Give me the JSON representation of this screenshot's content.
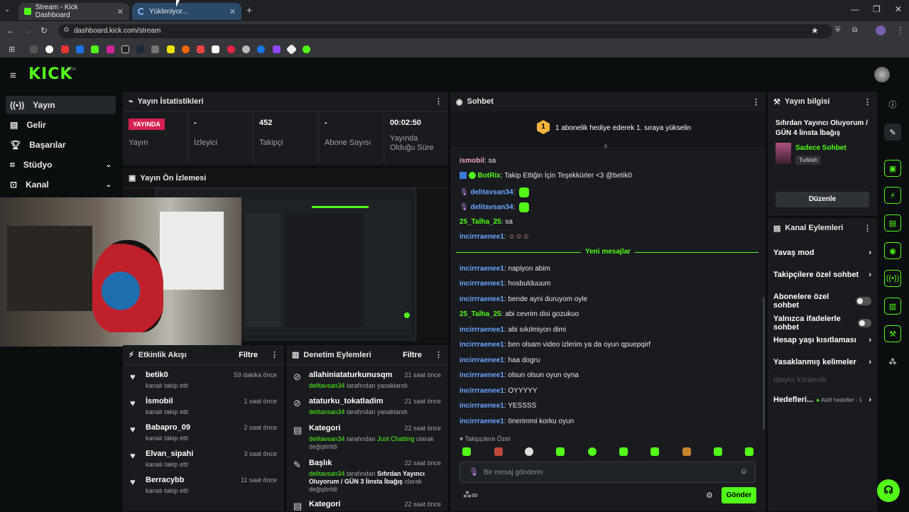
{
  "browser": {
    "tabs": [
      {
        "title": "Stream - Kick Dashboard"
      },
      {
        "title": "Yükleniyor..."
      }
    ],
    "url": "dashboard.kick.com/stream",
    "new_tab": "+"
  },
  "app": {
    "logo": "KICK",
    "badge": "BETA",
    "accent": "#53fc18",
    "live_color": "#d6204f"
  },
  "sidebar": {
    "items": [
      {
        "label": "Yayın",
        "icon": "broadcast-icon"
      },
      {
        "label": "Gelir",
        "icon": "revenue-icon"
      },
      {
        "label": "Başarılar",
        "icon": "trophy-icon"
      },
      {
        "label": "Stüdyo",
        "icon": "studio-icon"
      },
      {
        "label": "Kanal",
        "icon": "channel-icon"
      }
    ]
  },
  "stats": {
    "title": "Yayın İstatistikleri",
    "live_badge": "YAYINDA",
    "live_label": "Yayın",
    "viewers_value": "-",
    "viewers_label": "İzleyici",
    "followers_value": "452",
    "followers_label": "Takipçi",
    "subs_value": "-",
    "subs_label": "Abone Sayısı",
    "duration_value": "00:02:50",
    "duration_label": "Yayında Olduğu Süre"
  },
  "preview": {
    "title": "Yayın Ön İzlemesi"
  },
  "activity": {
    "title": "Etkinlik Akışı",
    "filter": "Filtre",
    "items": [
      {
        "name": "betik0",
        "sub": "kanalı takip etti",
        "time": "59 dakika önce"
      },
      {
        "name": "İsmobil",
        "sub": "kanalı takip etti",
        "time": "1 saat önce"
      },
      {
        "name": "Babapro_09",
        "sub": "kanalı takip etti",
        "time": "2 saat önce"
      },
      {
        "name": "Elvan_sipahi",
        "sub": "kanalı takip etti",
        "time": "3 saat önce"
      },
      {
        "name": "Berracybb",
        "sub": "kanalı takip etti",
        "time": "11 saat önce"
      }
    ]
  },
  "moderation": {
    "title": "Denetim Eylemleri",
    "filter": "Filtre",
    "items": [
      {
        "name": "allahiniataturkunusqm",
        "user": "delitavsan34",
        "rest": "tarafından yasaklandı",
        "time": "21 saat önce"
      },
      {
        "name": "ataturku_tokatladim",
        "user": "delitavsan34",
        "rest": "tarafından yasaklandı",
        "time": "21 saat önce"
      },
      {
        "name": "Kategori",
        "user": "delitavsan34",
        "mid": "tarafından",
        "value": "Just Chatting",
        "rest": "olarak değiştirildi",
        "time": "22 saat önce"
      },
      {
        "name": "Başlık",
        "user": "delitavsan34",
        "mid": "tarafından",
        "value": "Sıfırdan Yayıncı Oluyorum / GÜN 3 İinsta İbağış",
        "rest": "olarak değiştirildi",
        "time": "22 saat önce"
      },
      {
        "name": "Kategori",
        "time": "22 saat önce"
      }
    ]
  },
  "chat": {
    "title": "Sohbet",
    "pinned_rank": "1",
    "pinned": "1 abonelik hediye ederek 1. sıraya yükselin",
    "new_messages": "Yeni mesajlar",
    "messages": [
      {
        "user": "ismobil",
        "text": "sa"
      },
      {
        "user": "BotRix",
        "text": "Takip Ettiğin İçin Teşekkürler <3 @betik0"
      },
      {
        "user": "delitavsan34",
        "text": ""
      },
      {
        "user": "delitavsan34",
        "text": ""
      },
      {
        "user": "25_Talha_25",
        "text": "sa"
      },
      {
        "user": "incirrraenee1",
        "text": ""
      },
      {
        "user": "incirrraenee1",
        "text": "napiyon abim"
      },
      {
        "user": "incirrraenee1",
        "text": "hosbulduuum"
      },
      {
        "user": "incirrraenee1",
        "text": "bende ayni duruyom oyle"
      },
      {
        "user": "25_Talha_25",
        "text": "abi cevrim disi gozukuo"
      },
      {
        "user": "incirrraenee1",
        "text": "abi sıkılmiyon dimi"
      },
      {
        "user": "incirrraenee1",
        "text": "ben olsam video izlerim ya da oyun qpuepqirf"
      },
      {
        "user": "incirrraenee1",
        "text": "haa dogru"
      },
      {
        "user": "incirrraenee1",
        "text": "olsun olsun oyun oyna"
      },
      {
        "user": "incirrraenee1",
        "text": "OYYYYY"
      },
      {
        "user": "incirrraenee1",
        "text": "YESSSS"
      },
      {
        "user": "incirrraenee1",
        "text": "önerimmi korku oyun"
      }
    ],
    "followers_only": "Takipçilere Özel",
    "placeholder": "Bir mesaj gönderin",
    "send": "Gönder"
  },
  "stream_info": {
    "title": "Yayın bilgisi",
    "stream_title": "Sıfırdan Yayıncı Oluyorum / GÜN 4 İinsta İbağış",
    "category": "Sadece Sohbet",
    "language": "Turkish",
    "edit": "Düzenle"
  },
  "channel_actions": {
    "title": "Kanal Eylemleri",
    "items": [
      {
        "label": "Yavaş mod",
        "kind": "chevron"
      },
      {
        "label": "Takipçilere özel sohbet",
        "kind": "chevron"
      },
      {
        "label": "Abonelere özel sohbet",
        "kind": "toggle"
      },
      {
        "label": "Yalnızca ifadelerle sohbet",
        "kind": "toggle"
      },
      {
        "label": "Hesap yaşı kısıtlaması",
        "kind": "chevron"
      },
      {
        "label": "Yasaklanmış kelimeler",
        "kind": "chevron"
      }
    ],
    "viewer_redirect": "İzleyici Yönlendir",
    "goals": "Hedefleri...",
    "goals_sub": "Aktif hedefler - 1"
  }
}
